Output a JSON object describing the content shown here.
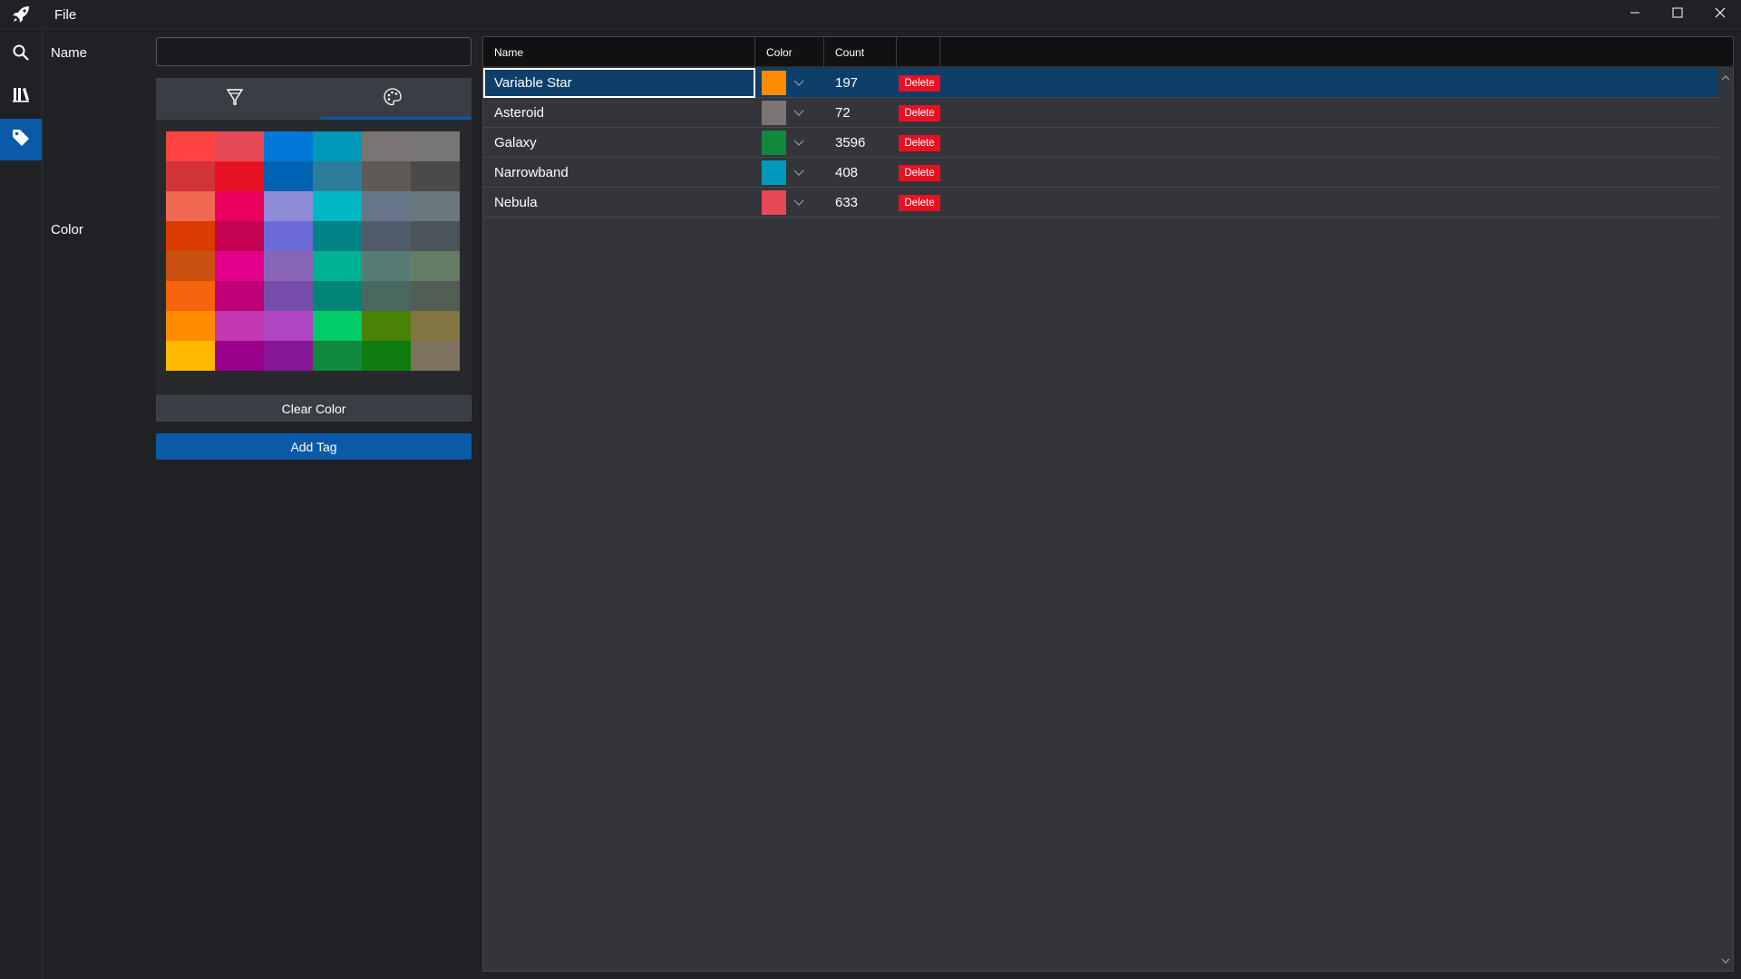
{
  "titlebar": {
    "menu_file": "File",
    "icons": [
      "rocket-icon",
      "minimize-icon",
      "maximize-icon",
      "close-icon"
    ]
  },
  "navrail": {
    "items": [
      {
        "name": "search",
        "icon": "search-icon"
      },
      {
        "name": "library",
        "icon": "library-icon"
      },
      {
        "name": "tags",
        "icon": "tag-icon",
        "active": true
      }
    ]
  },
  "form": {
    "name_label": "Name",
    "name_value": "",
    "color_label": "Color",
    "picker_tabs": [
      {
        "icon": "color-fill-icon"
      },
      {
        "icon": "palette-icon",
        "active": true
      }
    ],
    "swatches": [
      "#ff4343",
      "#e74856",
      "#0078d7",
      "#0099bc",
      "#7a7574",
      "#767676",
      "#d13438",
      "#e81123",
      "#0063b1",
      "#2d7d9a",
      "#5d5a58",
      "#4c4a48",
      "#ef6950",
      "#ea005e",
      "#8e8cd8",
      "#00b7c3",
      "#68768a",
      "#69797e",
      "#da3b01",
      "#c30052",
      "#6b69d6",
      "#038387",
      "#515c6b",
      "#4a5459",
      "#ca5010",
      "#e3008c",
      "#8764b8",
      "#00b294",
      "#567c73",
      "#647c64",
      "#f7630c",
      "#bf0077",
      "#744da9",
      "#018574",
      "#486860",
      "#525e54",
      "#ff8c00",
      "#c239b3",
      "#b146c2",
      "#00cc6a",
      "#498205",
      "#847545",
      "#ffb900",
      "#9a0089",
      "#881798",
      "#10893e",
      "#107c10",
      "#7e735f"
    ],
    "clear_color_label": "Clear Color",
    "add_tag_label": "Add Tag"
  },
  "table": {
    "columns": [
      "Name",
      "Color",
      "Count",
      ""
    ],
    "rows": [
      {
        "name": "Variable Star",
        "color": "#ff8c00",
        "count": "197",
        "action": "Delete",
        "selected": true
      },
      {
        "name": "Asteroid",
        "color": "#7a7574",
        "count": "72",
        "action": "Delete"
      },
      {
        "name": "Galaxy",
        "color": "#10893e",
        "count": "3596",
        "action": "Delete"
      },
      {
        "name": "Narrowband",
        "color": "#0099bc",
        "count": "408",
        "action": "Delete"
      },
      {
        "name": "Nebula",
        "color": "#e74856",
        "count": "633",
        "action": "Delete"
      }
    ]
  },
  "colors": {
    "accent": "#0a5aa8",
    "delete": "#e81123",
    "background": "#1f2125",
    "table_background": "#33353b"
  }
}
